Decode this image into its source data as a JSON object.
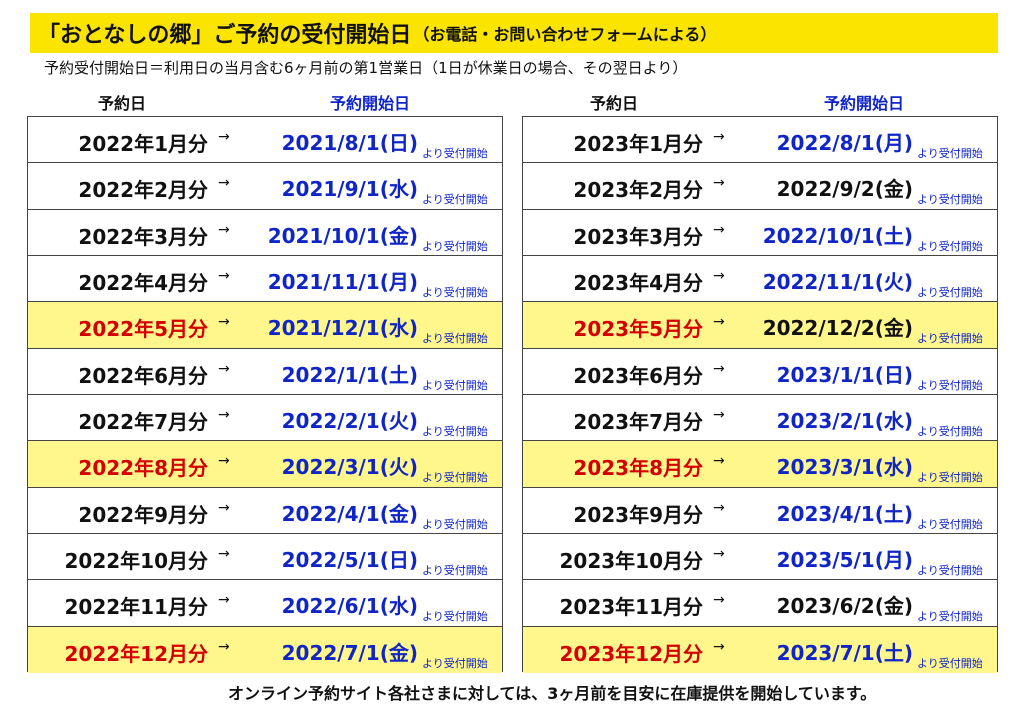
{
  "title": "「おとなしの郷」ご予約の受付開始日",
  "title_sub": "（お電話・お問い合わせフォームによる）",
  "subtitle": "予約受付開始日＝利用日の当月含む6ヶ月前の第1営業日（1日が休業日の場合、その翌日より）",
  "headers": {
    "left_reservation": "予約日",
    "left_start": "予約開始日",
    "right_reservation": "予約日",
    "right_start": "予約開始日"
  },
  "arrow": "→",
  "note": "より受付開始",
  "colors": {
    "title_bg": "#fbe400",
    "highlight_bg": "#fff68c",
    "blue": "#1025c6",
    "red": "#d40000"
  },
  "tables": {
    "left": [
      {
        "month": "2022年1月分",
        "date": "2021/8/1(日)",
        "highlight": false,
        "date_color": "blue"
      },
      {
        "month": "2022年2月分",
        "date": "2021/9/1(水)",
        "highlight": false,
        "date_color": "blue"
      },
      {
        "month": "2022年3月分",
        "date": "2021/10/1(金)",
        "highlight": false,
        "date_color": "blue"
      },
      {
        "month": "2022年4月分",
        "date": "2021/11/1(月)",
        "highlight": false,
        "date_color": "blue"
      },
      {
        "month": "2022年5月分",
        "date": "2021/12/1(水)",
        "highlight": true,
        "date_color": "blue"
      },
      {
        "month": "2022年6月分",
        "date": "2022/1/1(土)",
        "highlight": false,
        "date_color": "blue"
      },
      {
        "month": "2022年7月分",
        "date": "2022/2/1(火)",
        "highlight": false,
        "date_color": "blue"
      },
      {
        "month": "2022年8月分",
        "date": "2022/3/1(火)",
        "highlight": true,
        "date_color": "blue"
      },
      {
        "month": "2022年9月分",
        "date": "2022/4/1(金)",
        "highlight": false,
        "date_color": "blue"
      },
      {
        "month": "2022年10月分",
        "date": "2022/5/1(日)",
        "highlight": false,
        "date_color": "blue"
      },
      {
        "month": "2022年11月分",
        "date": "2022/6/1(水)",
        "highlight": false,
        "date_color": "blue"
      },
      {
        "month": "2022年12月分",
        "date": "2022/7/1(金)",
        "highlight": true,
        "date_color": "blue"
      }
    ],
    "right": [
      {
        "month": "2023年1月分",
        "date": "2022/8/1(月)",
        "highlight": false,
        "date_color": "blue"
      },
      {
        "month": "2023年2月分",
        "date": "2022/9/2(金)",
        "highlight": false,
        "date_color": "black"
      },
      {
        "month": "2023年3月分",
        "date": "2022/10/1(土)",
        "highlight": false,
        "date_color": "blue"
      },
      {
        "month": "2023年4月分",
        "date": "2022/11/1(火)",
        "highlight": false,
        "date_color": "blue"
      },
      {
        "month": "2023年5月分",
        "date": "2022/12/2(金)",
        "highlight": true,
        "date_color": "black"
      },
      {
        "month": "2023年6月分",
        "date": "2023/1/1(日)",
        "highlight": false,
        "date_color": "blue"
      },
      {
        "month": "2023年7月分",
        "date": "2023/2/1(水)",
        "highlight": false,
        "date_color": "blue"
      },
      {
        "month": "2023年8月分",
        "date": "2023/3/1(水)",
        "highlight": true,
        "date_color": "blue"
      },
      {
        "month": "2023年9月分",
        "date": "2023/4/1(土)",
        "highlight": false,
        "date_color": "blue"
      },
      {
        "month": "2023年10月分",
        "date": "2023/5/1(月)",
        "highlight": false,
        "date_color": "blue"
      },
      {
        "month": "2023年11月分",
        "date": "2023/6/2(金)",
        "highlight": false,
        "date_color": "black"
      },
      {
        "month": "2023年12月分",
        "date": "2023/7/1(土)",
        "highlight": true,
        "date_color": "blue"
      }
    ]
  },
  "footer": "オンライン予約サイト各社さまに対しては、3ヶ月前を目安に在庫提供を開始しています。"
}
